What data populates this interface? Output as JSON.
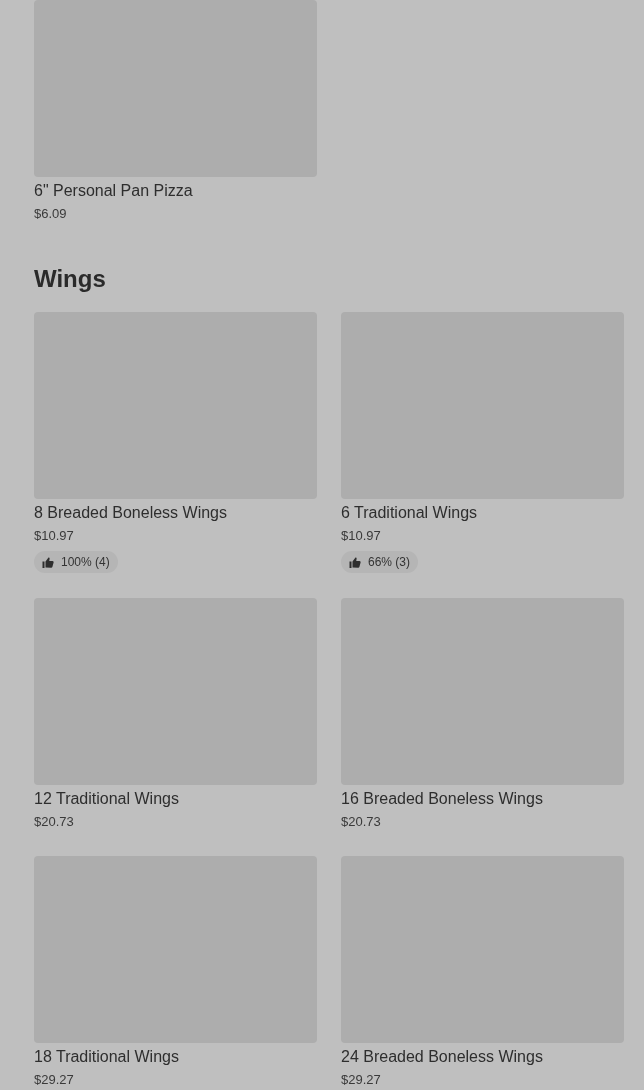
{
  "top_items": [
    {
      "name": "6\" Personal Pan Pizza",
      "price": "$6.09"
    }
  ],
  "sections": [
    {
      "title": "Wings",
      "items": [
        {
          "name": "8 Breaded Boneless Wings",
          "price": "$10.97",
          "rating": "100% (4)"
        },
        {
          "name": "6 Traditional Wings",
          "price": "$10.97",
          "rating": "66% (3)"
        },
        {
          "name": "12 Traditional Wings",
          "price": "$20.73"
        },
        {
          "name": "16 Breaded Boneless Wings",
          "price": "$20.73"
        },
        {
          "name": "18 Traditional Wings",
          "price": "$29.27"
        },
        {
          "name": "24 Breaded Boneless Wings",
          "price": "$29.27"
        }
      ]
    }
  ]
}
